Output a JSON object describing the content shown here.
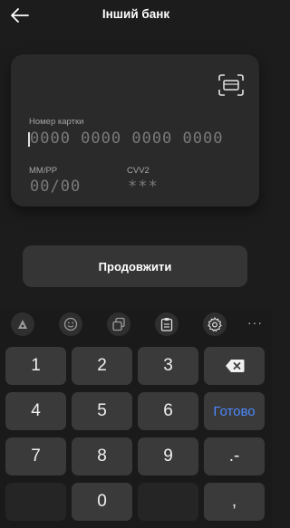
{
  "header": {
    "title": "Інший банк",
    "back_icon": "arrow-left-icon"
  },
  "card": {
    "scan_icon": "scan-card-icon",
    "number_label": "Номер картки",
    "number_placeholder": "0000 0000 0000 0000",
    "expiry_label": "ММ/РР",
    "expiry_placeholder": "00/00",
    "cvv_label": "CVV2",
    "cvv_placeholder": "***"
  },
  "continue_label": "Продовжити",
  "keyboard": {
    "toolbar_icons": [
      "sticker-icon",
      "emoji-icon",
      "copy-icon",
      "clipboard-icon",
      "settings-icon",
      "more-icon"
    ],
    "more_label": "···",
    "keys": {
      "k1": "1",
      "k2": "2",
      "k3": "3",
      "k4": "4",
      "k5": "5",
      "k6": "6",
      "k7": "7",
      "k8": "8",
      "k9": "9",
      "k0": "0",
      "done": "Готово",
      "dot_minus": ".-",
      "comma": ",",
      "backspace_icon": "backspace-icon"
    }
  },
  "colors": {
    "background": "#1c1c1c",
    "card": "#2a2a2a",
    "accent_blue": "#4c89ff"
  }
}
